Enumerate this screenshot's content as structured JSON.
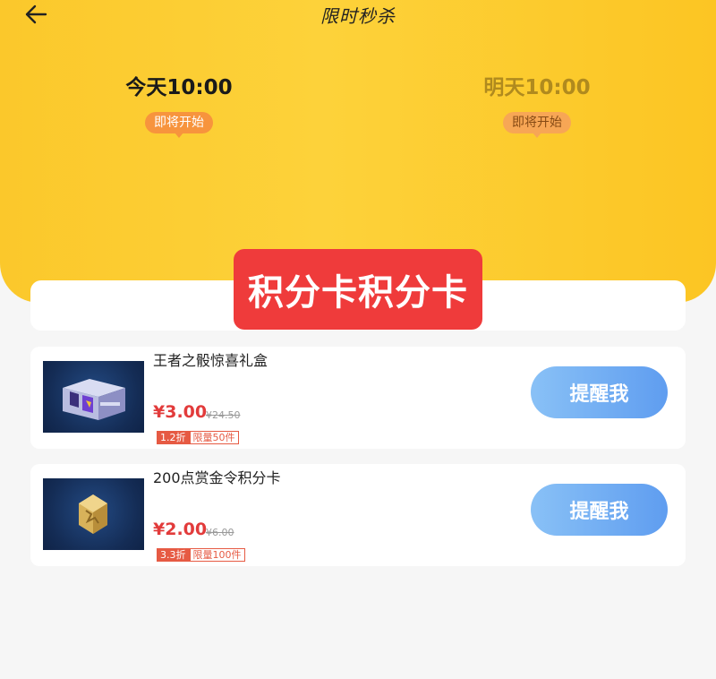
{
  "header": {
    "title": "限时秒杀",
    "back_icon": "arrow-left-icon"
  },
  "sessions": [
    {
      "time": "今天10:00",
      "status": "即将开始"
    },
    {
      "time": "明天10:00",
      "status": "即将开始"
    }
  ],
  "tab_overlay": {
    "label": "积分卡积分卡",
    "color": "#ef3b3b"
  },
  "items": [
    {
      "name": "王者之骰惊喜礼盒",
      "price": "¥3.00",
      "original_price": "¥24.50",
      "discount": "1.2折",
      "limit": "限量50件",
      "button": "提醒我",
      "image": "purple-gift-box-icon"
    },
    {
      "name": "200点赏金令积分卡",
      "price": "¥2.00",
      "original_price": "¥6.00",
      "discount": "3.3折",
      "limit": "限量100件",
      "button": "提醒我",
      "image": "gold-token-icon"
    }
  ],
  "colors": {
    "accent_yellow": "#fcc523",
    "price_red": "#e23b3b",
    "button_blue": "#5f9df0"
  }
}
